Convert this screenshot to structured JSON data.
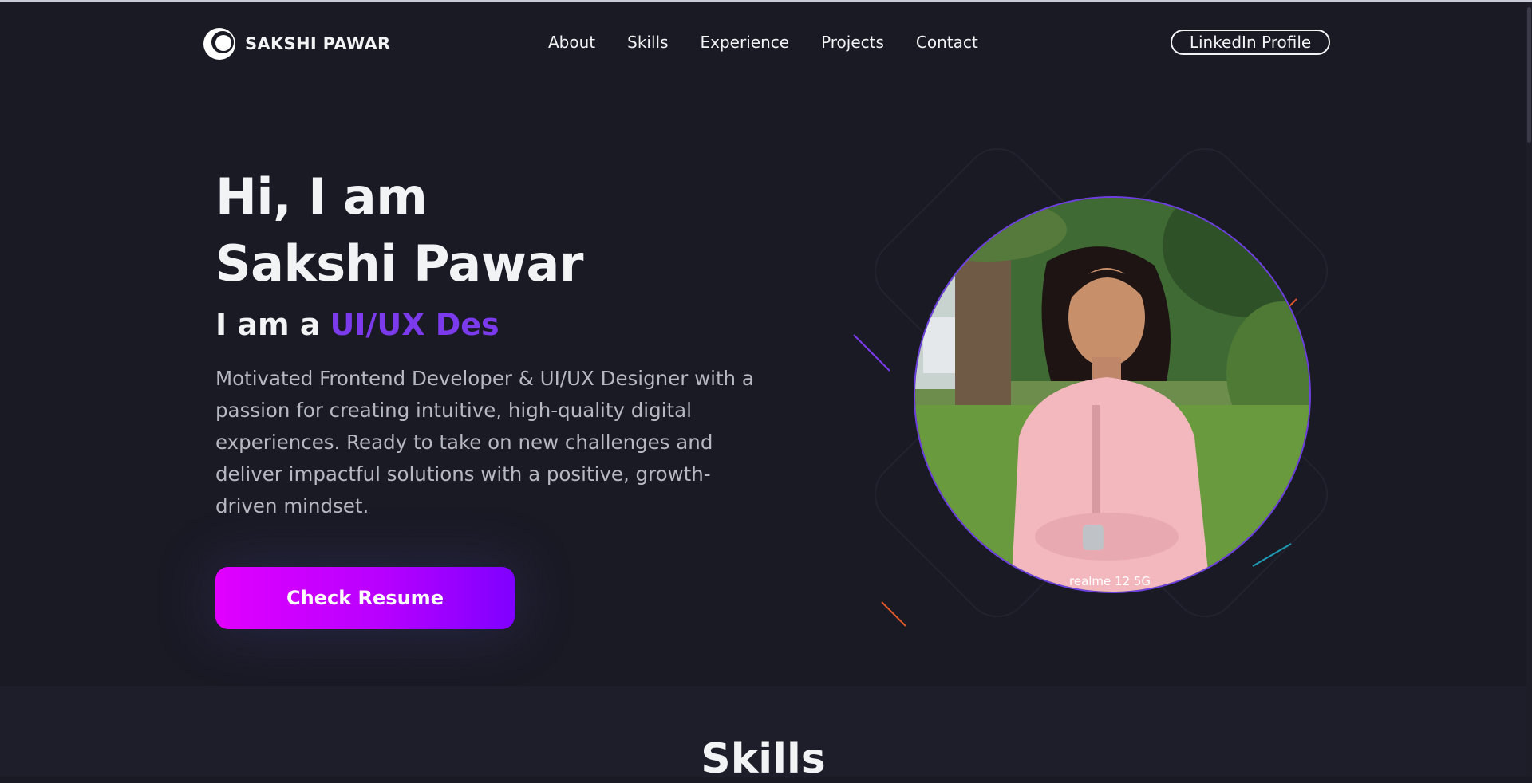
{
  "brand": {
    "name": "SAKSHI PAWAR",
    "logo_icon": "crescent-circle-logo"
  },
  "nav": {
    "items": [
      "About",
      "Skills",
      "Experience",
      "Projects",
      "Contact"
    ],
    "cta_label": "LinkedIn Profile"
  },
  "hero": {
    "greeting": "Hi, I am",
    "name": "Sakshi Pawar",
    "role_prefix": "I am a",
    "role_typed": "UI/UX Des",
    "description": "Motivated Frontend Developer & UI/UX Designer with a passion for creating intuitive, high-quality digital experiences. Ready to take on new challenges and deliver impactful solutions with a positive, growth-driven mindset.",
    "resume_button": "Check Resume",
    "photo_watermark": "realme 12 5G"
  },
  "skills": {
    "title": "Skills"
  },
  "colors": {
    "background": "#1a1a25",
    "accent": "#7c3aed",
    "button_gradient_start": "#e100ff",
    "button_gradient_end": "#7f00ff",
    "text": "#f2f3f5",
    "muted_text": "#b6b8c2"
  }
}
